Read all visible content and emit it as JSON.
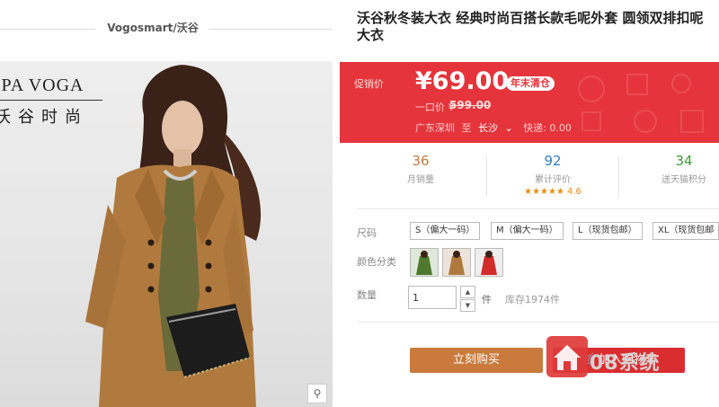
{
  "store": {
    "name": "Vogosmart/沃谷"
  },
  "photo": {
    "brand_en": "OPA VOGA",
    "brand_cn": "沃谷时尚"
  },
  "product": {
    "title_line1": "沃谷秋冬装大衣 经典时尚百搭长款毛呢外套 圆领双排扣呢",
    "title_line2": "大衣"
  },
  "price": {
    "promo_label": "促销价",
    "current": "¥69.00",
    "badge": "年末清仓",
    "original_label": "一口价 ¥",
    "original": "599.00",
    "ship_from": "广东深圳",
    "ship_to_word": "至",
    "ship_dest": "长沙",
    "ship_fee": "快递: 0.00"
  },
  "stats": {
    "sales": {
      "value": "36",
      "label": "月销量"
    },
    "reviews": {
      "value": "92",
      "label": "累计评价",
      "rating": "4.6"
    },
    "points": {
      "value": "34",
      "label": "送天猫积分"
    }
  },
  "options": {
    "size_label": "尺码",
    "sizes": [
      "S（偏大一码）",
      "M（偏大一码）",
      "L（现货包邮）",
      "XL（现货包邮"
    ],
    "color_label": "颜色分类",
    "qty_label": "数量",
    "qty_value": "1",
    "unit": "件",
    "stock": "库存1974件"
  },
  "buttons": {
    "buy": "立刻购买",
    "cart": "加入购物车"
  },
  "watermark": {
    "text": "08系统"
  },
  "colors": {
    "price_bg": "#e5343b",
    "buy_btn": "#c97a3c",
    "cart_btn": "#d92d2f"
  },
  "icons": {
    "zoom": "magnifier-icon",
    "cart": "cart-icon",
    "dropdown": "chevron-down-icon"
  }
}
